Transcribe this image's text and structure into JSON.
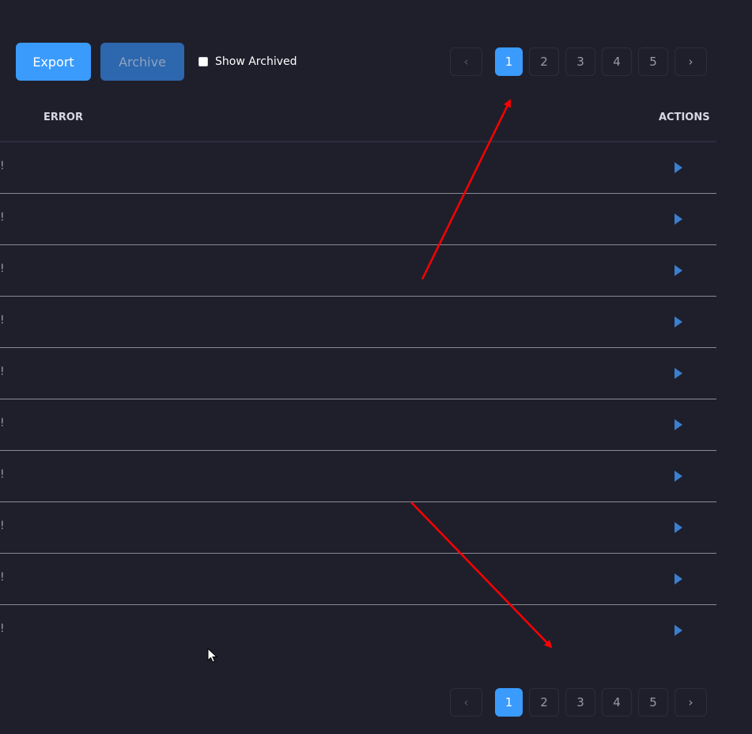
{
  "toolbar": {
    "export_label": "Export",
    "archive_label": "Archive",
    "show_archived_label": "Show Archived",
    "show_archived_checked": false
  },
  "pagination": {
    "prev_icon": "chevron-left-icon",
    "next_icon": "chevron-right-icon",
    "prev_glyph": "‹",
    "next_glyph": "›",
    "pages": [
      "1",
      "2",
      "3",
      "4",
      "5"
    ],
    "current_page": "1"
  },
  "table": {
    "columns": {
      "error": "ERROR",
      "actions": "ACTIONS"
    },
    "rows": [
      {
        "error": "!"
      },
      {
        "error": "!"
      },
      {
        "error": "!"
      },
      {
        "error": "!"
      },
      {
        "error": "!"
      },
      {
        "error": "!"
      },
      {
        "error": "!"
      },
      {
        "error": "!"
      },
      {
        "error": "!"
      },
      {
        "error": "!"
      }
    ],
    "action_icon": "play-triangle-icon"
  },
  "colors": {
    "background": "#1f1f2c",
    "accent": "#3a9bfd",
    "archive_button": "#2d67ad",
    "action_icon": "#3a7fd0",
    "annotation_arrow": "#ff0000"
  }
}
